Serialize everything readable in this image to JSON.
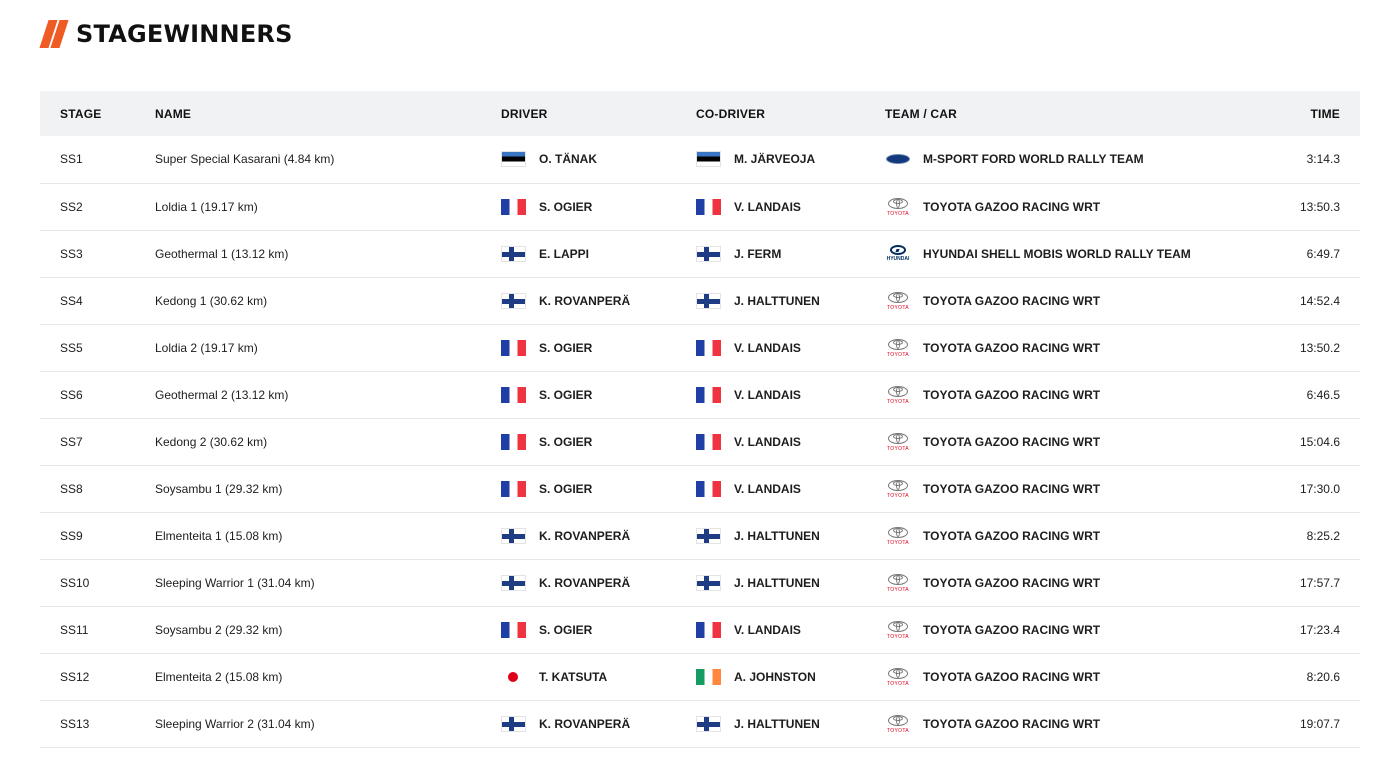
{
  "page": {
    "title": "STAGEWINNERS"
  },
  "columns": {
    "stage": "STAGE",
    "name": "NAME",
    "driver": "DRIVER",
    "codriver": "CO-DRIVER",
    "team": "TEAM / CAR",
    "time": "TIME"
  },
  "rows": [
    {
      "stage": "SS1",
      "name": "Super Special Kasarani (4.84 km)",
      "driver": "O. TÄNAK",
      "driver_flag": "ee",
      "codriver": "M. JÄRVEOJA",
      "codriver_flag": "ee",
      "team": "M-SPORT FORD WORLD RALLY TEAM",
      "team_logo": "ford-logo-icon",
      "time": "3:14.3"
    },
    {
      "stage": "SS2",
      "name": "Loldia 1 (19.17 km)",
      "driver": "S. OGIER",
      "driver_flag": "fr",
      "codriver": "V. LANDAIS",
      "codriver_flag": "fr",
      "team": "TOYOTA GAZOO RACING WRT",
      "team_logo": "toyota-logo-icon",
      "time": "13:50.3"
    },
    {
      "stage": "SS3",
      "name": "Geothermal 1 (13.12 km)",
      "driver": "E. LAPPI",
      "driver_flag": "fi",
      "codriver": "J. FERM",
      "codriver_flag": "fi",
      "team": "HYUNDAI SHELL MOBIS WORLD RALLY TEAM",
      "team_logo": "hyundai-logo-icon",
      "time": "6:49.7"
    },
    {
      "stage": "SS4",
      "name": "Kedong 1 (30.62 km)",
      "driver": "K. ROVANPERÄ",
      "driver_flag": "fi",
      "codriver": "J. HALTTUNEN",
      "codriver_flag": "fi",
      "team": "TOYOTA GAZOO RACING WRT",
      "team_logo": "toyota-logo-icon",
      "time": "14:52.4"
    },
    {
      "stage": "SS5",
      "name": "Loldia 2 (19.17 km)",
      "driver": "S. OGIER",
      "driver_flag": "fr",
      "codriver": "V. LANDAIS",
      "codriver_flag": "fr",
      "team": "TOYOTA GAZOO RACING WRT",
      "team_logo": "toyota-logo-icon",
      "time": "13:50.2"
    },
    {
      "stage": "SS6",
      "name": "Geothermal 2 (13.12 km)",
      "driver": "S. OGIER",
      "driver_flag": "fr",
      "codriver": "V. LANDAIS",
      "codriver_flag": "fr",
      "team": "TOYOTA GAZOO RACING WRT",
      "team_logo": "toyota-logo-icon",
      "time": "6:46.5"
    },
    {
      "stage": "SS7",
      "name": "Kedong 2 (30.62 km)",
      "driver": "S. OGIER",
      "driver_flag": "fr",
      "codriver": "V. LANDAIS",
      "codriver_flag": "fr",
      "team": "TOYOTA GAZOO RACING WRT",
      "team_logo": "toyota-logo-icon",
      "time": "15:04.6"
    },
    {
      "stage": "SS8",
      "name": "Soysambu 1 (29.32 km)",
      "driver": "S. OGIER",
      "driver_flag": "fr",
      "codriver": "V. LANDAIS",
      "codriver_flag": "fr",
      "team": "TOYOTA GAZOO RACING WRT",
      "team_logo": "toyota-logo-icon",
      "time": "17:30.0"
    },
    {
      "stage": "SS9",
      "name": "Elmenteita 1 (15.08 km)",
      "driver": "K. ROVANPERÄ",
      "driver_flag": "fi",
      "codriver": "J. HALTTUNEN",
      "codriver_flag": "fi",
      "team": "TOYOTA GAZOO RACING WRT",
      "team_logo": "toyota-logo-icon",
      "time": "8:25.2"
    },
    {
      "stage": "SS10",
      "name": "Sleeping Warrior 1 (31.04 km)",
      "driver": "K. ROVANPERÄ",
      "driver_flag": "fi",
      "codriver": "J. HALTTUNEN",
      "codriver_flag": "fi",
      "team": "TOYOTA GAZOO RACING WRT",
      "team_logo": "toyota-logo-icon",
      "time": "17:57.7"
    },
    {
      "stage": "SS11",
      "name": "Soysambu 2 (29.32 km)",
      "driver": "S. OGIER",
      "driver_flag": "fr",
      "codriver": "V. LANDAIS",
      "codriver_flag": "fr",
      "team": "TOYOTA GAZOO RACING WRT",
      "team_logo": "toyota-logo-icon",
      "time": "17:23.4"
    },
    {
      "stage": "SS12",
      "name": "Elmenteita 2 (15.08 km)",
      "driver": "T. KATSUTA",
      "driver_flag": "jp",
      "codriver": "A. JOHNSTON",
      "codriver_flag": "ie",
      "team": "TOYOTA GAZOO RACING WRT",
      "team_logo": "toyota-logo-icon",
      "time": "8:20.6"
    },
    {
      "stage": "SS13",
      "name": "Sleeping Warrior 2 (31.04 km)",
      "driver": "K. ROVANPERÄ",
      "driver_flag": "fi",
      "codriver": "J. HALTTUNEN",
      "codriver_flag": "fi",
      "team": "TOYOTA GAZOO RACING WRT",
      "team_logo": "toyota-logo-icon",
      "time": "19:07.7"
    }
  ],
  "logo_words": {
    "toyota": "TOYOTA",
    "hyundai": "HYUNDAI"
  },
  "colors": {
    "accent": "#f05a23",
    "header_bg": "#f1f2f3",
    "row_border": "#e6e7e8",
    "toyota_red": "#e2001a",
    "hyundai_blue": "#002c5f",
    "ford_blue": "#133a7c"
  }
}
